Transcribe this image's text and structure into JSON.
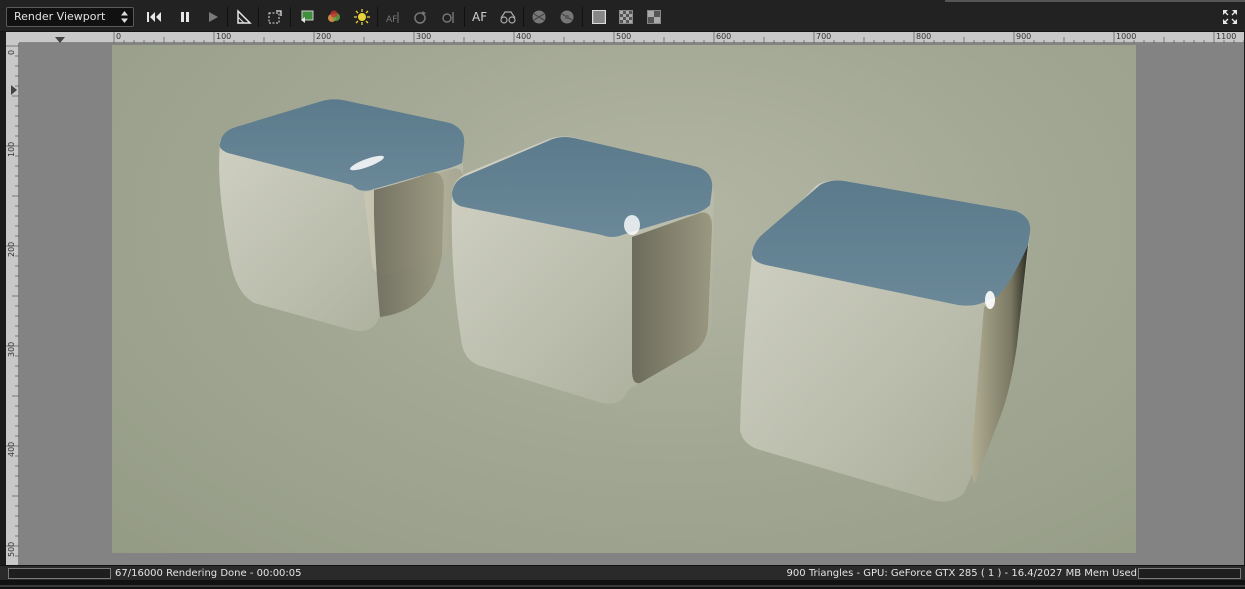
{
  "toolbar": {
    "mode_select": "Render Viewport",
    "af_label": "AF",
    "af2_label": "AF",
    "icons": [
      "skip-to-start-icon",
      "pause-icon",
      "play-icon",
      "ruler-icon",
      "region-icon",
      "import-icon",
      "material-icon",
      "light-icon",
      "autofocus-icon",
      "rotate-icon",
      "pick-focus-icon",
      "focus-icon",
      "glasses-icon",
      "sphere-icon",
      "sphere-alt-icon",
      "checker-fine-icon",
      "checker-medium-icon",
      "checker-coarse-icon",
      "fullscreen-icon"
    ]
  },
  "ruler": {
    "top_labels": [
      "0",
      "100",
      "200",
      "300",
      "400",
      "500",
      "600",
      "700",
      "800",
      "900",
      "1000",
      "1100"
    ],
    "left_labels": [
      "0",
      "100",
      "200",
      "300",
      "400",
      "500"
    ]
  },
  "status": {
    "left": "67/16000 Rendering Done - 00:00:05",
    "right": "900 Triangles - GPU: GeForce GTX 285 ( 1 ) - 16.4/2027 MB Mem Used"
  },
  "colors": {
    "background": "#a3a895",
    "cube_top": "#5e7d8f",
    "cube_side": "#c4c4b4"
  }
}
